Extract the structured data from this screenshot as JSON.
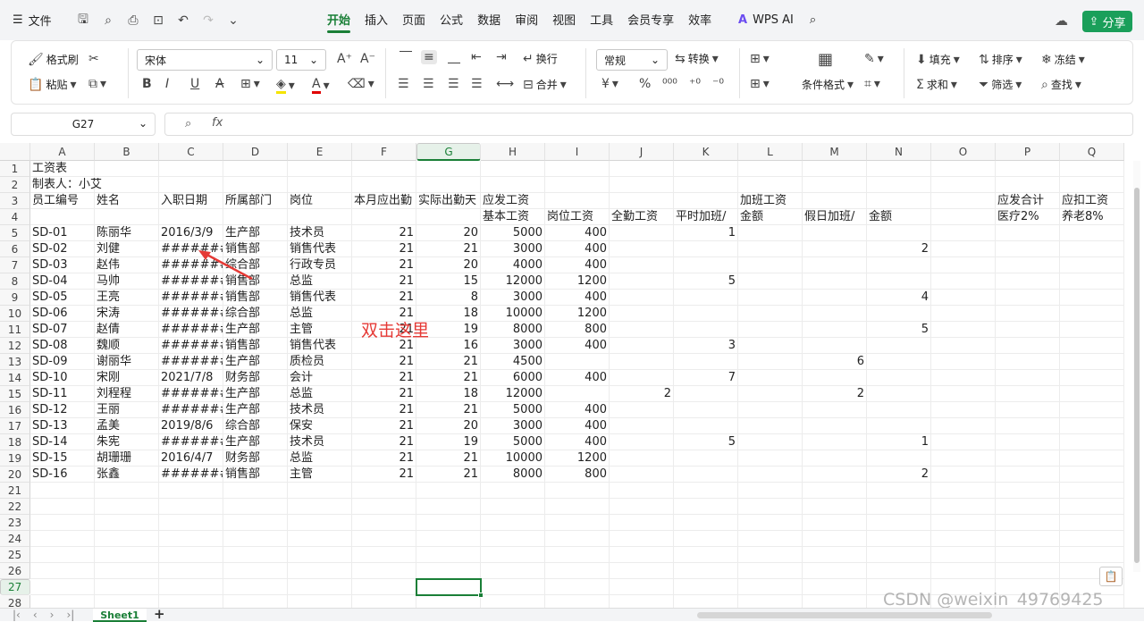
{
  "topbar": {
    "file_menu": "文件",
    "tabs": [
      "开始",
      "插入",
      "页面",
      "公式",
      "数据",
      "审阅",
      "视图",
      "工具",
      "会员专享",
      "效率"
    ],
    "active_tab": "开始",
    "wps_ai": "WPS AI",
    "share": "分享"
  },
  "ribbon": {
    "format_painter": "格式刷",
    "paste": "粘贴",
    "font_name": "宋体",
    "font_size": "11",
    "wrap": "换行",
    "merge": "合并",
    "number_format": "常规",
    "convert": "转换",
    "cond_format": "条件格式",
    "fill": "填充",
    "sort": "排序",
    "freeze": "冻结",
    "sum": "求和",
    "filter": "筛选",
    "find": "查找"
  },
  "formula_bar": {
    "name_box": "G27",
    "fx_label": "fx",
    "content": ""
  },
  "grid": {
    "columns": [
      "A",
      "B",
      "C",
      "D",
      "E",
      "F",
      "G",
      "H",
      "I",
      "J",
      "K",
      "L",
      "M",
      "N",
      "O",
      "P",
      "Q"
    ],
    "rows": [
      "1",
      "2",
      "3",
      "4",
      "5",
      "6",
      "7",
      "8",
      "9",
      "10",
      "11",
      "12",
      "13",
      "14",
      "15",
      "16",
      "17",
      "18",
      "19",
      "20",
      "21",
      "22",
      "23",
      "24",
      "25",
      "26",
      "27",
      "28"
    ],
    "selected_column": "G",
    "selected_row": "27",
    "title": "工资表",
    "maker": "制表人：小艾",
    "header_row3": [
      "员工编号",
      "姓名",
      "入职日期",
      "所属部门",
      "岗位",
      "本月应出勤",
      "实际出勤天",
      "应发工资",
      "",
      "",
      "",
      "加班工资",
      "",
      "",
      "",
      "应发合计",
      "应扣工资"
    ],
    "header_row4": [
      "",
      "",
      "",
      "",
      "",
      "",
      "",
      "基本工资",
      "岗位工资",
      "全勤工资",
      "平时加班/",
      "金额",
      "假日加班/",
      "金额",
      "",
      "医疗2%",
      "养老8%"
    ],
    "records": [
      [
        "SD-01",
        "陈丽华",
        "2016/3/9",
        "生产部",
        "技术员",
        "21",
        "20",
        "5000",
        "400",
        "",
        "1",
        "",
        "",
        "",
        ""
      ],
      [
        "SD-02",
        "刘健",
        "########",
        "销售部",
        "销售代表",
        "21",
        "21",
        "3000",
        "400",
        "",
        "",
        "",
        "",
        "2",
        ""
      ],
      [
        "SD-03",
        "赵伟",
        "########",
        "综合部",
        "行政专员",
        "21",
        "20",
        "4000",
        "400",
        "",
        "",
        "",
        "",
        "",
        ""
      ],
      [
        "SD-04",
        "马帅",
        "########",
        "销售部",
        "总监",
        "21",
        "15",
        "12000",
        "1200",
        "",
        "5",
        "",
        "",
        "",
        ""
      ],
      [
        "SD-05",
        "王亮",
        "########",
        "销售部",
        "销售代表",
        "21",
        "8",
        "3000",
        "400",
        "",
        "",
        "",
        "",
        "4",
        ""
      ],
      [
        "SD-06",
        "宋涛",
        "########",
        "综合部",
        "总监",
        "21",
        "18",
        "10000",
        "1200",
        "",
        "",
        "",
        "",
        "",
        ""
      ],
      [
        "SD-07",
        "赵倩",
        "########",
        "生产部",
        "主管",
        "21",
        "19",
        "8000",
        "800",
        "",
        "",
        "",
        "",
        "5",
        ""
      ],
      [
        "SD-08",
        "魏顺",
        "########",
        "销售部",
        "销售代表",
        "21",
        "16",
        "3000",
        "400",
        "",
        "3",
        "",
        "",
        "",
        ""
      ],
      [
        "SD-09",
        "谢丽华",
        "########",
        "生产部",
        "质检员",
        "21",
        "21",
        "4500",
        "",
        "",
        "",
        "",
        "6",
        "",
        ""
      ],
      [
        "SD-10",
        "宋刚",
        "2021/7/8",
        "财务部",
        "会计",
        "21",
        "21",
        "6000",
        "400",
        "",
        "7",
        "",
        "",
        "",
        ""
      ],
      [
        "SD-11",
        "刘程程",
        "########",
        "生产部",
        "总监",
        "21",
        "18",
        "12000",
        "",
        "2",
        "",
        "",
        "2",
        "",
        ""
      ],
      [
        "SD-12",
        "王丽",
        "########",
        "生产部",
        "技术员",
        "21",
        "21",
        "5000",
        "400",
        "",
        "",
        "",
        "",
        "",
        ""
      ],
      [
        "SD-13",
        "孟美",
        "2019/8/6",
        "综合部",
        "保安",
        "21",
        "20",
        "3000",
        "400",
        "",
        "",
        "",
        "",
        "",
        ""
      ],
      [
        "SD-14",
        "朱宪",
        "########",
        "生产部",
        "技术员",
        "21",
        "19",
        "5000",
        "400",
        "",
        "5",
        "",
        "",
        "1",
        ""
      ],
      [
        "SD-15",
        "胡珊珊",
        "2016/4/7",
        "财务部",
        "总监",
        "21",
        "21",
        "10000",
        "1200",
        "",
        "",
        "",
        "",
        "",
        ""
      ],
      [
        "SD-16",
        "张鑫",
        "########",
        "销售部",
        "主管",
        "21",
        "21",
        "8000",
        "800",
        "",
        "",
        "",
        "",
        "2",
        ""
      ]
    ]
  },
  "annotation": "双击这里",
  "sheet": {
    "name": "Sheet1"
  },
  "watermark": "CSDN @weixin_49769425",
  "colors": {
    "accent": "#1a7f37",
    "annotation": "#e53935"
  }
}
